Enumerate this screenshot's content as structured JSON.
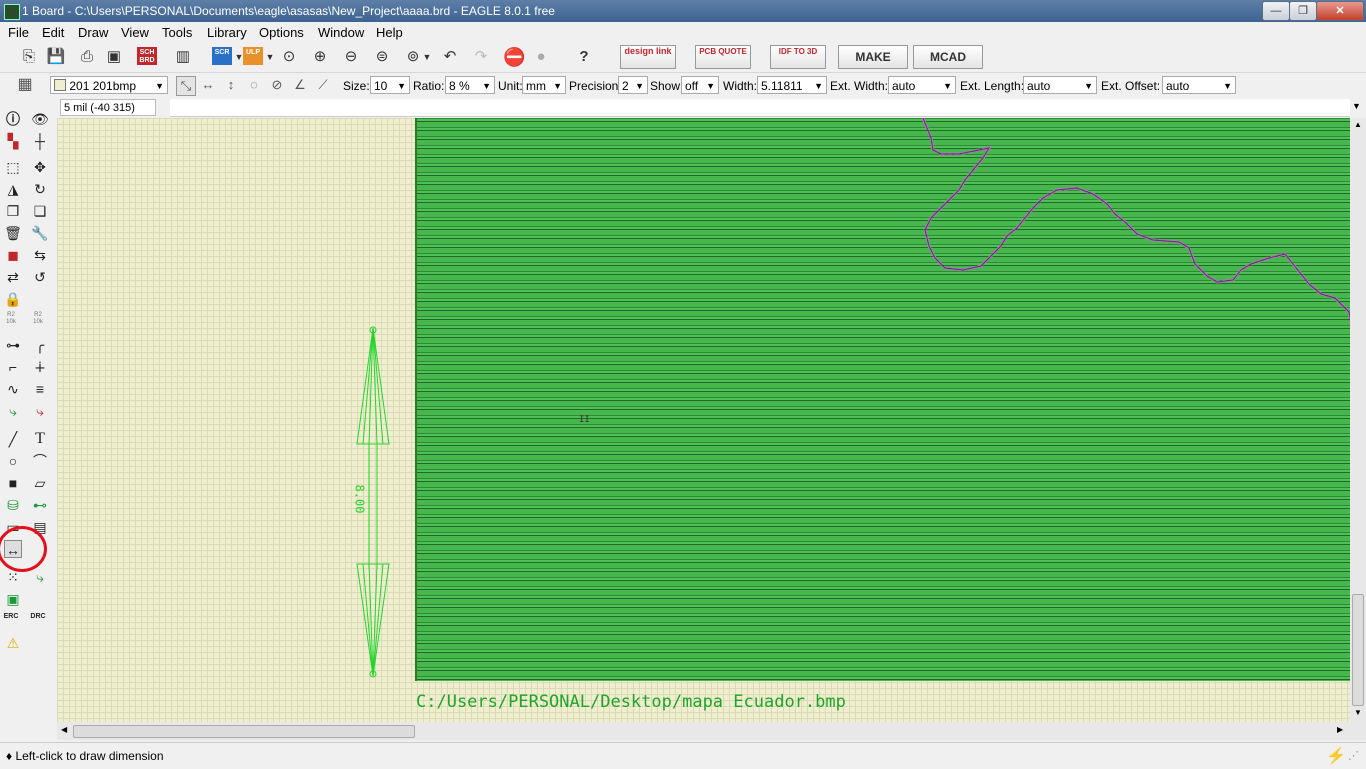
{
  "window": {
    "title": "1 Board - C:\\Users\\PERSONAL\\Documents\\eagle\\asasas\\New_Project\\aaaa.brd - EAGLE 8.0.1 free",
    "min_label": "—",
    "max_label": "❐",
    "close_label": "✕"
  },
  "menu": [
    "File",
    "Edit",
    "Draw",
    "View",
    "Tools",
    "Library",
    "Options",
    "Window",
    "Help"
  ],
  "toolbar1": {
    "sch_brd": "SCH BRD",
    "scr": "SCR",
    "ulp": "ULP",
    "design_link": "design link",
    "pcb_quote": "PCB QUOTE",
    "idf_to_3d": "IDF TO 3D",
    "make": "MAKE",
    "mcad": "MCAD",
    "help": "?"
  },
  "toolbar2": {
    "layer": "201 201bmp",
    "size_label": "Size:",
    "size_value": "10",
    "ratio_label": "Ratio:",
    "ratio_value": "8 %",
    "unit_label": "Unit:",
    "unit_value": "mm",
    "precision_label": "Precision:",
    "precision_value": "2",
    "show_label": "Show:",
    "show_value": "off",
    "width_label": "Width:",
    "width_value": "5.11811",
    "ext_width_label": "Ext. Width:",
    "ext_width_value": "auto",
    "ext_length_label": "Ext. Length:",
    "ext_length_value": "auto",
    "ext_offset_label": "Ext. Offset:",
    "ext_offset_value": "auto"
  },
  "coordinate": "5 mil (-40 315)",
  "left_tools": {
    "r2_10k": "R2 10k",
    "erc": "ERC",
    "drc": "DRC",
    "text": "T"
  },
  "canvas": {
    "board_label": "C:/Users/PERSONAL/Desktop/mapa Ecuador.bmp",
    "dimension_value": "8.00",
    "board_color": "#45b04b",
    "outline_color": "#cc66cc",
    "dimension_color": "#27d42f"
  },
  "status": "♦ Left-click to draw dimension",
  "highlight_color": "#e4101c"
}
